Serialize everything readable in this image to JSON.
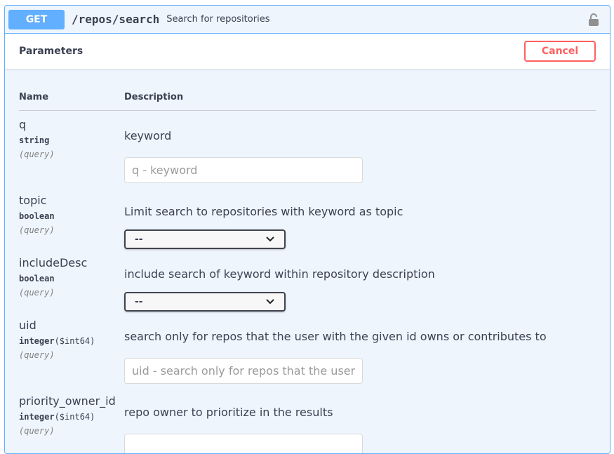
{
  "summary": {
    "method": "GET",
    "path": "/repos/search",
    "description": "Search for repositories",
    "lock_icon": "lock-icon"
  },
  "section": {
    "title": "Parameters",
    "cancel_label": "Cancel"
  },
  "columns": {
    "name": "Name",
    "description": "Description"
  },
  "params": [
    {
      "name": "q",
      "type": "string",
      "in": "(query)",
      "description": "keyword",
      "control": "input",
      "placeholder": "q - keyword",
      "value": ""
    },
    {
      "name": "topic",
      "type": "boolean",
      "in": "(query)",
      "description": "Limit search to repositories with keyword as topic",
      "control": "select",
      "selected": "--"
    },
    {
      "name": "includeDesc",
      "type": "boolean",
      "in": "(query)",
      "description": "include search of keyword within repository description",
      "control": "select",
      "selected": "--"
    },
    {
      "name": "uid",
      "type": "integer",
      "format": "($int64)",
      "in": "(query)",
      "description": "search only for repos that the user with the given id owns or contributes to",
      "control": "input",
      "placeholder": "uid - search only for repos that the user with the given id owns or contributes to",
      "value": ""
    },
    {
      "name": "priority_owner_id",
      "type": "integer",
      "format": "($int64)",
      "in": "(query)",
      "description": "repo owner to prioritize in the results",
      "control": "input",
      "placeholder": "",
      "value": ""
    }
  ],
  "colors": {
    "get_method": "#61affe",
    "cancel": "#ff6060",
    "block_bg": "#eef5fd"
  }
}
